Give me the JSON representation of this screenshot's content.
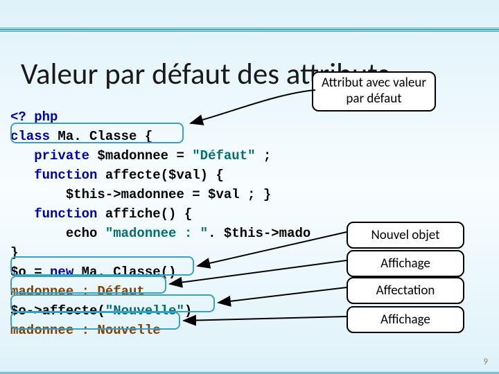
{
  "title": "Valeur par défaut des attributs",
  "callouts": {
    "main_l1": "Attribut avec valeur",
    "main_l2": "par défaut",
    "c1": "Nouvel objet",
    "c2": "Affichage",
    "c3": "Affectation",
    "c4": "Affichage"
  },
  "code": {
    "l1_a": "<? php",
    "l2_a": "class",
    "l2_b": " Ma. Classe {",
    "l3_a": "   private",
    "l3_b": " $madonnee = ",
    "l3_c": "\"Défaut\"",
    "l3_d": " ;",
    "l4_a": "   function",
    "l4_b": " affecte($val) {",
    "l5_a": "       $this->madonnee = $val ; }",
    "l6_a": "   function",
    "l6_b": " affiche() {",
    "l7_a": "       echo ",
    "l7_b": "\"madonnee : \"",
    "l7_c": ". $this->mado",
    "l8_a": "}",
    "l9_a": "$o = ",
    "l9_b": "new",
    "l9_c": " Ma. Classe()",
    "l10_a": "madonnee : Défaut",
    "l11_a": "$o->affecte(",
    "l11_b": "\"Nouvelle\"",
    "l11_c": ")",
    "l12_a": "madonnee : Nouvelle"
  },
  "page": "9"
}
